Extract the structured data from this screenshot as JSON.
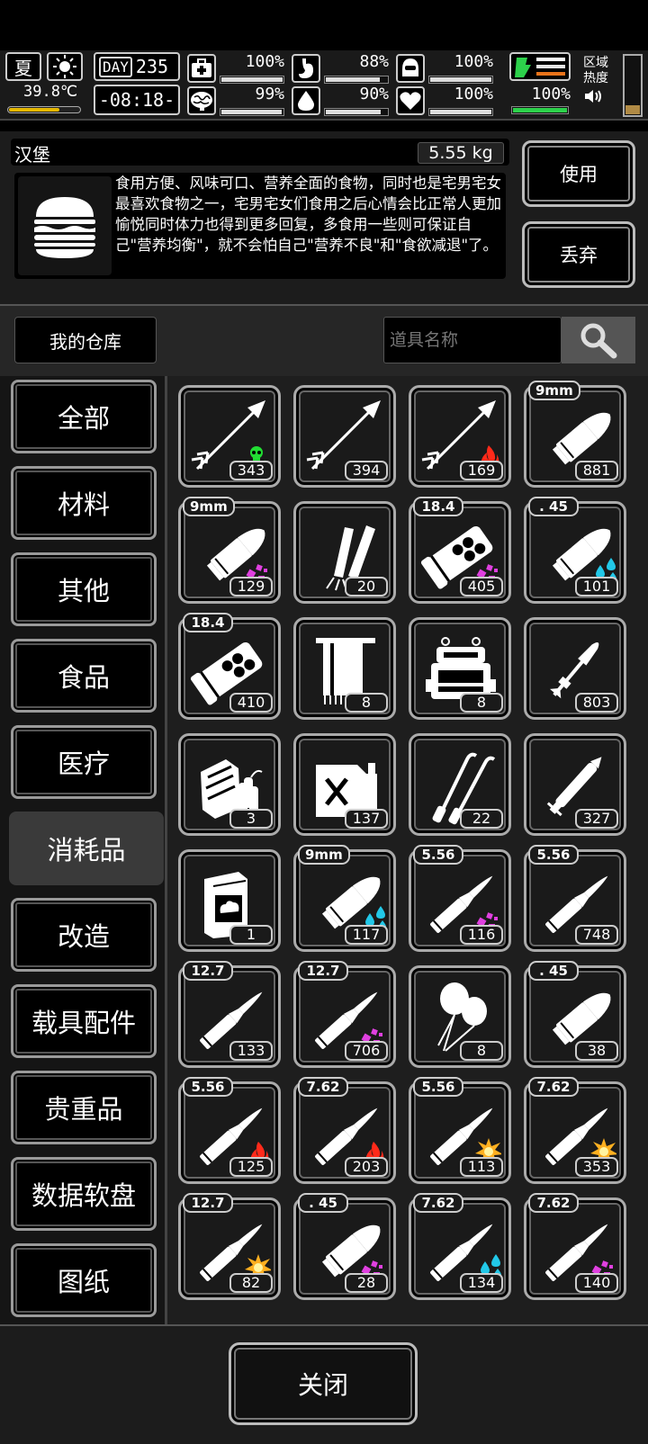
{
  "status": {
    "season": "夏",
    "weather_icon": "sun-icon",
    "temperature": "39.8℃",
    "temperature_level": 0.7,
    "day_tag": "DAY",
    "day_number": "235",
    "clock": "-08:18-",
    "stats": [
      {
        "name": "health",
        "icon": "medkit-icon",
        "value": "100%",
        "level": 1.0
      },
      {
        "name": "hunger",
        "icon": "stomach-icon",
        "value": "88%",
        "level": 0.88
      },
      {
        "name": "armor",
        "icon": "helmet-icon",
        "value": "100%",
        "level": 1.0
      },
      {
        "name": "brain",
        "icon": "brain-icon",
        "value": "99%",
        "level": 0.99
      },
      {
        "name": "thirst",
        "icon": "water-drop-icon",
        "value": "90%",
        "level": 0.9
      },
      {
        "name": "mood",
        "icon": "heart-icon",
        "value": "100%",
        "level": 1.0
      }
    ],
    "energy": {
      "icon": "stamina-icon",
      "value": "100%",
      "level": 1.0,
      "color": "#2dd14b"
    },
    "zone_heat_label_1": "区域",
    "zone_heat_label_2": "热度",
    "zone_heat_level": 0.15
  },
  "detail": {
    "name": "汉堡",
    "weight": "5.55 kg",
    "icon": "burger-icon",
    "description": "食用方便、风味可口、营养全面的食物，同时也是宅男宅女最喜欢食物之一，宅男宅女们食用之后心情会比正常人更加愉悦同时体力也得到更多回复，多食用一些则可保证自己\"营养均衡\"，就不会怕自己\"营养不良\"和\"食欲减退\"了。",
    "use_label": "使用",
    "drop_label": "丢弃"
  },
  "warehouse": {
    "label": "我的仓库",
    "search_placeholder": "道具名称"
  },
  "categories": [
    "全部",
    "材料",
    "其他",
    "食品",
    "医疗",
    "消耗品",
    "改造",
    "载具配件",
    "贵重品",
    "数据软盘",
    "图纸"
  ],
  "active_category": "消耗品",
  "items": [
    {
      "kind": "arrow",
      "effect": "poison",
      "caliber": "",
      "count": "343"
    },
    {
      "kind": "arrow",
      "effect": "",
      "caliber": "",
      "count": "394"
    },
    {
      "kind": "arrow",
      "effect": "fire",
      "caliber": "",
      "count": "169"
    },
    {
      "kind": "pistol",
      "effect": "",
      "caliber": "9mm",
      "count": "881"
    },
    {
      "kind": "pistol",
      "effect": "spark",
      "caliber": "9mm",
      "count": "129"
    },
    {
      "kind": "flares",
      "effect": "",
      "caliber": "",
      "count": "20"
    },
    {
      "kind": "shell",
      "effect": "spark",
      "caliber": "18.4",
      "count": "405"
    },
    {
      "kind": "pistol",
      "effect": "water",
      "caliber": ". 45",
      "count": "101"
    },
    {
      "kind": "shell",
      "effect": "",
      "caliber": "18.4",
      "count": "410"
    },
    {
      "kind": "towel",
      "effect": "",
      "caliber": "",
      "count": "8"
    },
    {
      "kind": "machine",
      "effect": "",
      "caliber": "",
      "count": "8"
    },
    {
      "kind": "rocket",
      "effect": "",
      "caliber": "",
      "count": "803"
    },
    {
      "kind": "bundle",
      "effect": "",
      "caliber": "",
      "count": "3"
    },
    {
      "kind": "jerrycan",
      "effect": "",
      "caliber": "",
      "count": "137"
    },
    {
      "kind": "picks",
      "effect": "",
      "caliber": "",
      "count": "22"
    },
    {
      "kind": "pen",
      "effect": "",
      "caliber": "",
      "count": "327"
    },
    {
      "kind": "box",
      "effect": "",
      "caliber": "",
      "count": "1"
    },
    {
      "kind": "pistol",
      "effect": "water",
      "caliber": "9mm",
      "count": "117"
    },
    {
      "kind": "rifle",
      "effect": "spark",
      "caliber": "5.56",
      "count": "116"
    },
    {
      "kind": "rifle",
      "effect": "",
      "caliber": "5.56",
      "count": "748"
    },
    {
      "kind": "rifle",
      "effect": "",
      "caliber": "12.7",
      "count": "133"
    },
    {
      "kind": "rifle",
      "effect": "spark",
      "caliber": "12.7",
      "count": "706"
    },
    {
      "kind": "balloons",
      "effect": "",
      "caliber": "",
      "count": "8"
    },
    {
      "kind": "pistol",
      "effect": "",
      "caliber": ". 45",
      "count": "38"
    },
    {
      "kind": "rifle",
      "effect": "fire",
      "caliber": "5.56",
      "count": "125"
    },
    {
      "kind": "rifle",
      "effect": "fire",
      "caliber": "7.62",
      "count": "203"
    },
    {
      "kind": "rifle",
      "effect": "explode",
      "caliber": "5.56",
      "count": "113"
    },
    {
      "kind": "rifle",
      "effect": "explode",
      "caliber": "7.62",
      "count": "353"
    },
    {
      "kind": "rifle",
      "effect": "explode",
      "caliber": "12.7",
      "count": "82"
    },
    {
      "kind": "pistol",
      "effect": "spark",
      "caliber": ". 45",
      "count": "28"
    },
    {
      "kind": "rifle",
      "effect": "water",
      "caliber": "7.62",
      "count": "134"
    },
    {
      "kind": "rifle",
      "effect": "spark",
      "caliber": "7.62",
      "count": "140"
    }
  ],
  "close_label": "关闭",
  "colors": {
    "poison": "#22dd33",
    "fire": "#ff2a1a",
    "spark": "#e040e0",
    "water": "#22c8e8",
    "explode": "#ffb020"
  }
}
